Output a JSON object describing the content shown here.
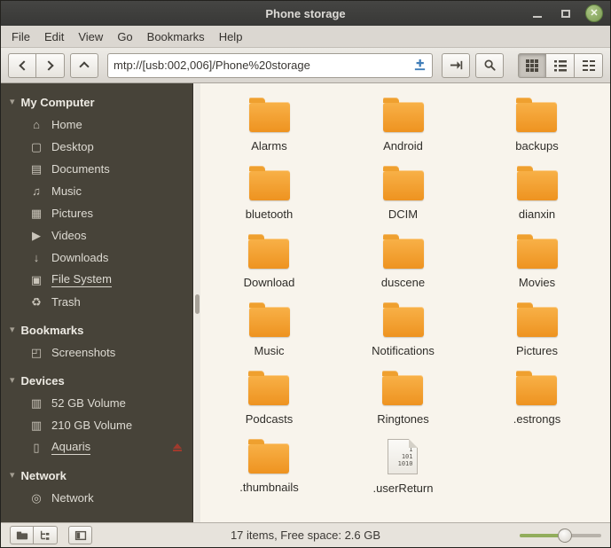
{
  "window": {
    "title": "Phone storage",
    "controls": {
      "minimize": "minimize-button",
      "maximize": "maximize-button",
      "close": "close-button",
      "close_glyph": "✕"
    }
  },
  "menubar": {
    "items": [
      "File",
      "Edit",
      "View",
      "Go",
      "Bookmarks",
      "Help"
    ]
  },
  "toolbar": {
    "location": "mtp://[usb:002,006]/Phone%20storage"
  },
  "sidebar": {
    "sections": [
      {
        "label": "My Computer",
        "items": [
          {
            "label": "Home",
            "icon": "home-icon"
          },
          {
            "label": "Desktop",
            "icon": "desktop-icon"
          },
          {
            "label": "Documents",
            "icon": "documents-icon"
          },
          {
            "label": "Music",
            "icon": "music-icon"
          },
          {
            "label": "Pictures",
            "icon": "pictures-icon"
          },
          {
            "label": "Videos",
            "icon": "videos-icon"
          },
          {
            "label": "Downloads",
            "icon": "downloads-icon"
          },
          {
            "label": "File System",
            "icon": "filesystem-icon",
            "underlined": true
          },
          {
            "label": "Trash",
            "icon": "trash-icon"
          }
        ]
      },
      {
        "label": "Bookmarks",
        "items": [
          {
            "label": "Screenshots",
            "icon": "folder-icon"
          }
        ]
      },
      {
        "label": "Devices",
        "items": [
          {
            "label": "52 GB Volume",
            "icon": "drive-icon"
          },
          {
            "label": "210 GB Volume",
            "icon": "drive-icon"
          },
          {
            "label": "Aquaris",
            "icon": "phone-icon",
            "underlined": true,
            "eject": true
          }
        ]
      },
      {
        "label": "Network",
        "items": [
          {
            "label": "Network",
            "icon": "network-icon"
          }
        ]
      }
    ]
  },
  "files": {
    "items": [
      {
        "name": "Alarms",
        "type": "folder"
      },
      {
        "name": "Android",
        "type": "folder"
      },
      {
        "name": "backups",
        "type": "folder"
      },
      {
        "name": "bluetooth",
        "type": "folder"
      },
      {
        "name": "DCIM",
        "type": "folder"
      },
      {
        "name": "dianxin",
        "type": "folder"
      },
      {
        "name": "Download",
        "type": "folder"
      },
      {
        "name": "duscene",
        "type": "folder"
      },
      {
        "name": "Movies",
        "type": "folder"
      },
      {
        "name": "Music",
        "type": "folder"
      },
      {
        "name": "Notifications",
        "type": "folder"
      },
      {
        "name": "Pictures",
        "type": "folder"
      },
      {
        "name": "Podcasts",
        "type": "folder"
      },
      {
        "name": "Ringtones",
        "type": "folder"
      },
      {
        "name": ".estrongs",
        "type": "folder"
      },
      {
        "name": ".thumbnails",
        "type": "folder"
      },
      {
        "name": ".userReturn",
        "type": "binary",
        "icon_lines": [
          "1",
          "101",
          "1010"
        ]
      }
    ]
  },
  "statusbar": {
    "text": "17 items, Free space: 2.6 GB"
  },
  "zoom": {
    "fill_percent": 55
  },
  "colors": {
    "accent_green": "#8fa876",
    "folder_orange": "#f0941f",
    "titlebar_bg": "#3a3a38",
    "sidebar_bg": "#474339",
    "content_bg": "#f8f4ec",
    "eject_red": "#a03a2d",
    "entry_icon_blue": "#3f7db8"
  }
}
